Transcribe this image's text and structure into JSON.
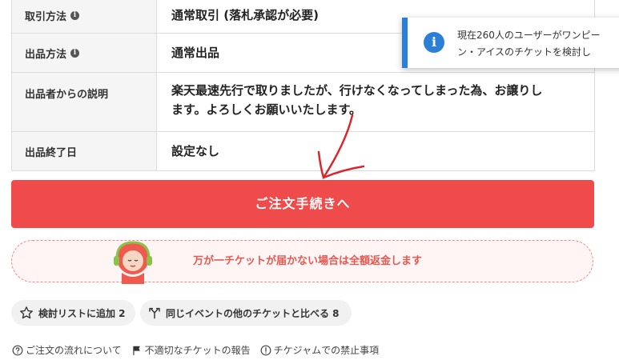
{
  "details": {
    "rows": [
      {
        "label": "取引方法",
        "value": "通常取引 (落札承認が必要)"
      },
      {
        "label": "出品方法",
        "value": "通常出品"
      },
      {
        "label": "出品者からの説明",
        "value_line1": "楽天最速先行で取りましたが、行けなくなってしまった為、お譲りし",
        "value_line2": "ます。よろしくお願いいたします。"
      },
      {
        "label": "出品終了日",
        "value": "設定なし"
      }
    ]
  },
  "toast": {
    "line1": "現在260人のユーザーがワンピー",
    "line2": "ン・アイスのチケットを検討し"
  },
  "order_button": {
    "label": "ご注文手続きへ"
  },
  "refund_banner": {
    "text": "万が一チケットが届かない場合は全額返金します"
  },
  "chips": {
    "watchlist": "検討リストに追加 2",
    "compare": "同じイベントの他のチケットと比べる 8"
  },
  "footer_links": {
    "order_flow": "ご注文の流れについて",
    "report": "不適切なチケットの報告",
    "prohibited": "チケジャムでの禁止事項"
  },
  "colors": {
    "accent_red": "#ef4b4b",
    "toast_blue": "#2b7fd4",
    "refund_text": "#e8584f"
  }
}
